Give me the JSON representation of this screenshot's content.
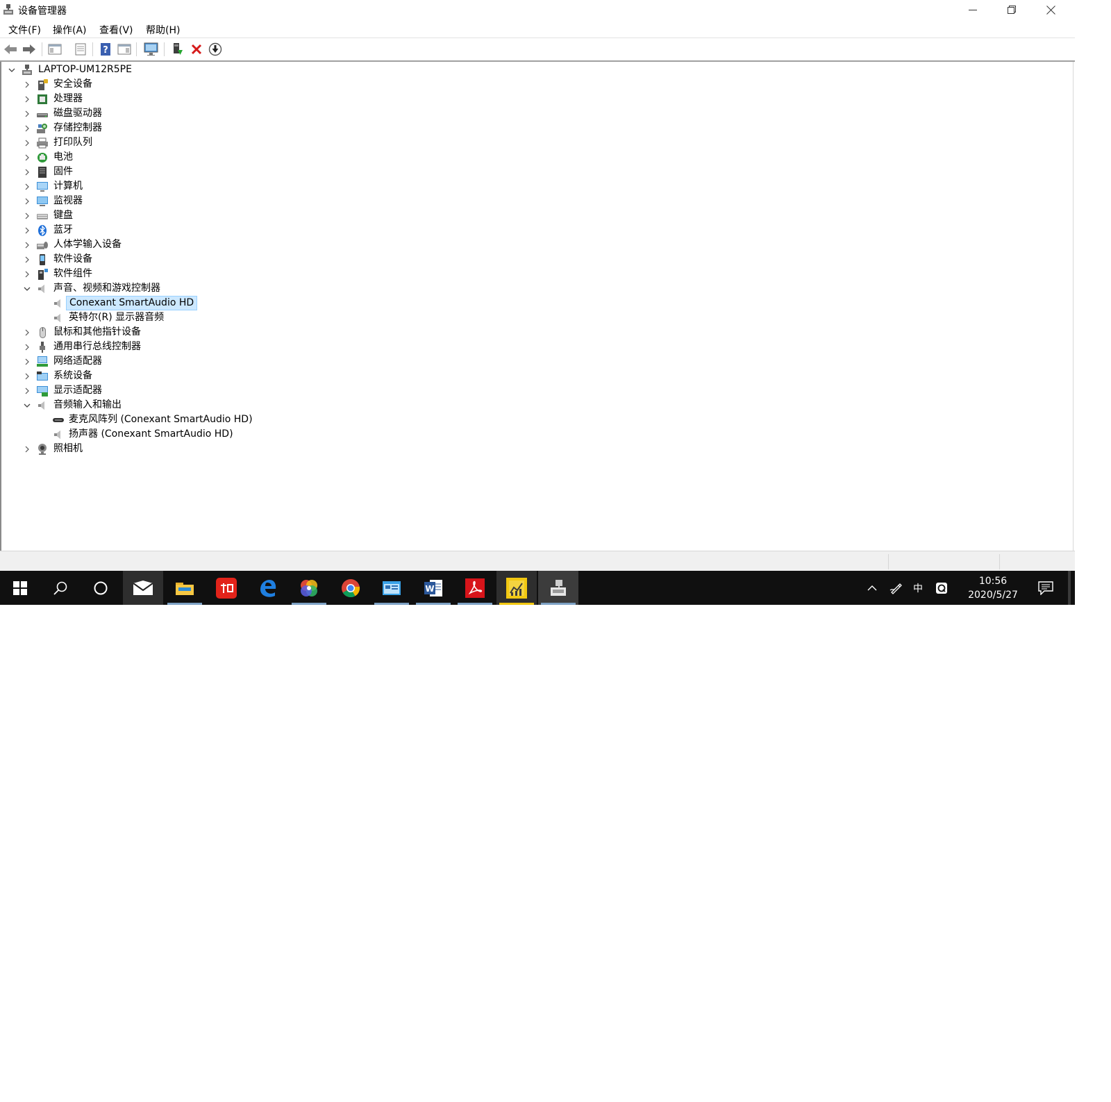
{
  "window": {
    "title": "设备管理器",
    "icons": {
      "app": "device-manager-icon",
      "minimize": "minimize-icon",
      "restore": "restore-icon",
      "close": "close-icon"
    }
  },
  "menubar": {
    "items": [
      "文件(F)",
      "操作(A)",
      "查看(V)",
      "帮助(H)"
    ]
  },
  "toolbar": {
    "buttons": [
      "back-arrow-icon",
      "forward-arrow-icon",
      "show-hide-tree-icon",
      "properties-icon",
      "help-icon",
      "action-pane-icon",
      "monitor-scan-icon",
      "update-driver-icon",
      "uninstall-x-icon",
      "download-driver-icon"
    ]
  },
  "tree": {
    "root": "LAPTOP-UM12R5PE",
    "categories": [
      {
        "label": "安全设备",
        "icon": "security-device-icon",
        "expanded": false
      },
      {
        "label": "处理器",
        "icon": "processor-icon",
        "expanded": false
      },
      {
        "label": "磁盘驱动器",
        "icon": "disk-drive-icon",
        "expanded": false
      },
      {
        "label": "存储控制器",
        "icon": "storage-controller-icon",
        "expanded": false
      },
      {
        "label": "打印队列",
        "icon": "printer-icon",
        "expanded": false
      },
      {
        "label": "电池",
        "icon": "battery-icon",
        "expanded": false
      },
      {
        "label": "固件",
        "icon": "firmware-icon",
        "expanded": false
      },
      {
        "label": "计算机",
        "icon": "computer-icon",
        "expanded": false
      },
      {
        "label": "监视器",
        "icon": "monitor-icon",
        "expanded": false
      },
      {
        "label": "键盘",
        "icon": "keyboard-icon",
        "expanded": false
      },
      {
        "label": "蓝牙",
        "icon": "bluetooth-icon",
        "expanded": false
      },
      {
        "label": "人体学输入设备",
        "icon": "hid-icon",
        "expanded": false
      },
      {
        "label": "软件设备",
        "icon": "software-device-icon",
        "expanded": false
      },
      {
        "label": "软件组件",
        "icon": "software-component-icon",
        "expanded": false
      },
      {
        "label": "声音、视频和游戏控制器",
        "icon": "speaker-icon",
        "expanded": true,
        "children": [
          {
            "label": "Conexant SmartAudio HD",
            "icon": "speaker-icon",
            "selected": true
          },
          {
            "label": "英特尔(R) 显示器音频",
            "icon": "speaker-icon",
            "selected": false
          }
        ]
      },
      {
        "label": "鼠标和其他指针设备",
        "icon": "mouse-icon",
        "expanded": false
      },
      {
        "label": "通用串行总线控制器",
        "icon": "usb-icon",
        "expanded": false
      },
      {
        "label": "网络适配器",
        "icon": "network-adapter-icon",
        "expanded": false
      },
      {
        "label": "系统设备",
        "icon": "system-device-icon",
        "expanded": false
      },
      {
        "label": "显示适配器",
        "icon": "display-adapter-icon",
        "expanded": false
      },
      {
        "label": "音频输入和输出",
        "icon": "speaker-icon",
        "expanded": true,
        "children": [
          {
            "label": "麦克风阵列 (Conexant SmartAudio HD)",
            "icon": "microphone-array-icon",
            "selected": false
          },
          {
            "label": "扬声器 (Conexant SmartAudio HD)",
            "icon": "speaker-icon",
            "selected": false
          }
        ]
      },
      {
        "label": "照相机",
        "icon": "camera-icon",
        "expanded": false
      }
    ]
  },
  "taskbar": {
    "apps": [
      "start-windows-icon",
      "search-icon",
      "cortana-circle-icon",
      "mail-icon",
      "file-explorer-icon",
      "youdao-dict-icon",
      "edge-icon",
      "photos-pinwheel-icon",
      "chrome-icon",
      "control-panel-icon",
      "word-icon",
      "acrobat-icon",
      "chart-app-icon",
      "device-manager-taskbar-icon"
    ],
    "tray_icons": [
      "show-hidden-icons-chevron",
      "pen-icon",
      "ime-indicator",
      "app-q-icon",
      "action-center-icon"
    ],
    "ime": "中",
    "time": "10:56",
    "date": "2020/5/27"
  },
  "colors": {
    "selection_bg": "#cce8ff",
    "selection_border": "#99d1ff",
    "taskbar_bg": "#101010",
    "taskbar_active": "#2e2e2e",
    "running_indicator": "#7da1c4"
  }
}
